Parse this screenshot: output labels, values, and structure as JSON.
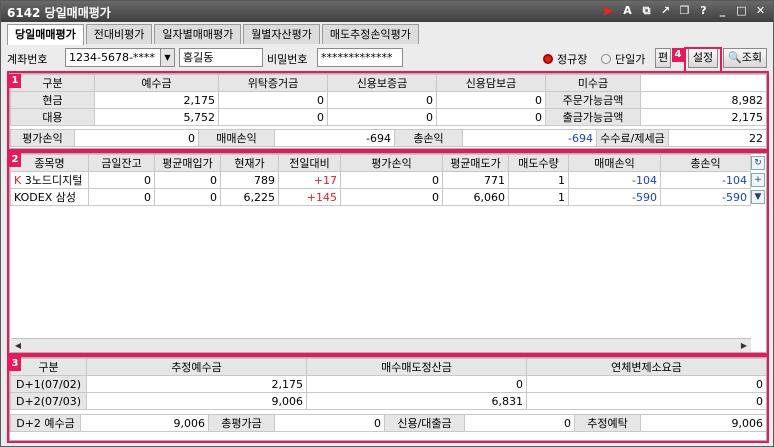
{
  "window": {
    "title": "6142  당일매매평가"
  },
  "titlebar_icons": [
    "play-icon",
    "font-icon",
    "copy-icon",
    "link-icon",
    "restore-icon",
    "help-icon",
    "minimize-icon",
    "maximize-icon",
    "close-icon"
  ],
  "tabs": [
    {
      "label": "당일매매평가",
      "active": true
    },
    {
      "label": "전대비평가"
    },
    {
      "label": "일자별매매평가"
    },
    {
      "label": "월별자산평가"
    },
    {
      "label": "매도추정손익평가"
    }
  ],
  "toolbar": {
    "account_label": "계좌번호",
    "account_value": "1234-5678-****",
    "name_value": "홍길동",
    "password_label": "비밀번호",
    "password_value": "*************",
    "radio_regular": "정규장",
    "radio_single": "단일가",
    "pyeon_label": "편",
    "setting_label": "설정",
    "query_label": "조회"
  },
  "markers": {
    "m1": "1",
    "m2": "2",
    "m3": "3",
    "m4": "4"
  },
  "summary": {
    "headers": [
      "구분",
      "예수금",
      "위탁증거금",
      "신용보증금",
      "신용담보금",
      "미수금",
      ""
    ],
    "rows": [
      [
        "현금",
        "2,175",
        "0",
        "0",
        "0",
        "주문가능금액",
        "8,982"
      ],
      [
        "대용",
        "5,752",
        "0",
        "0",
        "0",
        "출금가능금액",
        "2,175"
      ]
    ],
    "totals": {
      "eval_label": "평가손익",
      "eval_value": "0",
      "trade_label": "매매손익",
      "trade_value": "-694",
      "total_label": "총손익",
      "total_value": "-694",
      "fee_label": "수수료/제세금",
      "fee_value": "22"
    }
  },
  "holdings": {
    "headers": [
      "종목명",
      "금일잔고",
      "평균매입가",
      "현재가",
      "전일대비",
      "평가손익",
      "평균매도가",
      "매도수량",
      "매매손익",
      "총손익"
    ],
    "rows": [
      {
        "prefix": "K",
        "name": "3노드디지털",
        "balance": "0",
        "avg_buy": "0",
        "price": "789",
        "change": "+17",
        "eval": "0",
        "avg_sell": "771",
        "sell_qty": "1",
        "trade_pl": "-104",
        "total_pl": "-104"
      },
      {
        "prefix": "",
        "name": "KODEX 삼성",
        "balance": "0",
        "avg_buy": "0",
        "price": "6,225",
        "change": "+145",
        "eval": "0",
        "avg_sell": "6,060",
        "sell_qty": "1",
        "trade_pl": "-590",
        "total_pl": "-590"
      }
    ],
    "scroll_left": "◀",
    "scroll_right": "▶"
  },
  "estimates": {
    "headers": [
      "구분",
      "추정예수금",
      "매수매도정산금",
      "연체변제소요금"
    ],
    "rows": [
      [
        "D+1(07/02)",
        "2,175",
        "0",
        "0"
      ],
      [
        "D+2(07/03)",
        "9,006",
        "6,831",
        "0"
      ]
    ],
    "footer": {
      "d2_label": "D+2 예수금",
      "d2_value": "9,006",
      "total_eval_label": "총평가금",
      "total_eval_value": "0",
      "credit_label": "신용/대출금",
      "credit_value": "0",
      "est_deposit_label": "추정예탁",
      "est_deposit_value": "9,006"
    }
  },
  "colors": {
    "accent": "#e31b5c",
    "positive": "#e0202a",
    "negative": "#1c3fd0",
    "titlebar": "#4a4a4a"
  }
}
